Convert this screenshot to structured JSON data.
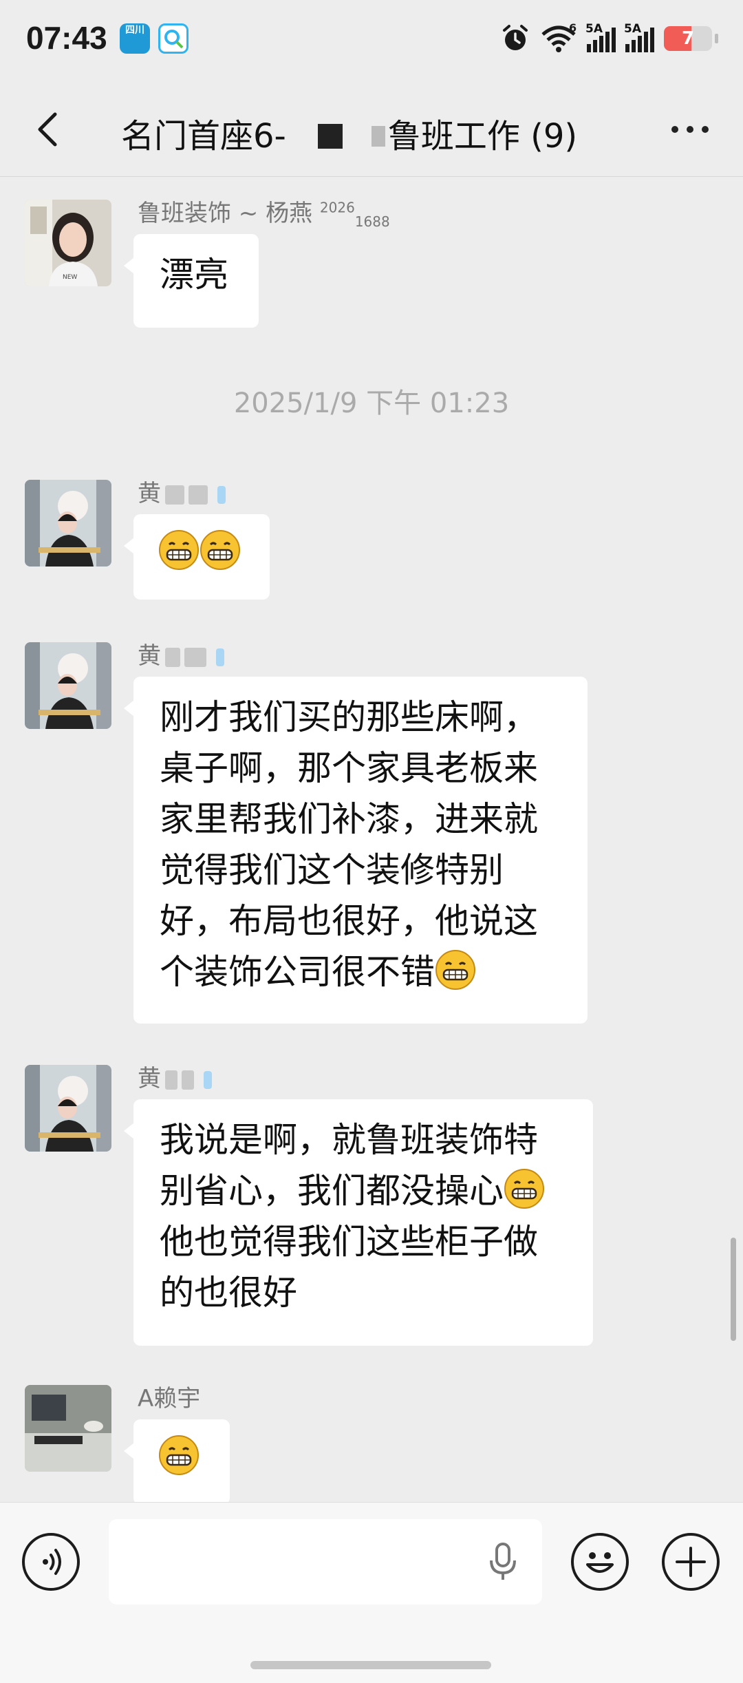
{
  "status_bar": {
    "time": "07:43",
    "app_badge_text": "四川",
    "signal1_label": "5A",
    "signal2_label": "5A",
    "wifi_label": "6",
    "battery_level": "7",
    "battery_fraction": 0.07,
    "icons": [
      "alarm-icon",
      "wifi-icon",
      "signal-icon",
      "signal-icon",
      "battery-icon"
    ]
  },
  "header": {
    "title_part1": "名门首座6-",
    "title_part2": "鲁班工作",
    "member_count": "(9)",
    "back_icon": "chevron-left-icon",
    "more_icon": "more-icon"
  },
  "messages": [
    {
      "sender": "鲁班装饰 ~ 杨燕",
      "sender_sup": "2026",
      "sender_sub": "1688",
      "text": "漂亮"
    },
    {
      "sender": "黄",
      "text": "",
      "emoji_count": 2
    },
    {
      "sender": "黄",
      "text_lines": [
        "刚才我们买的那些床啊，",
        "桌子啊，那个家具老板来",
        "家里帮我们补漆，进来就",
        "觉得我们这个装修特别",
        "好，布局也很好，他说这",
        "个装饰公司很不错"
      ]
    },
    {
      "sender": "黄",
      "text_lines": [
        "我说是啊，就鲁班装饰特",
        "别省心，我们都没操心",
        "他也觉得我们这些柜子做",
        "的也很好"
      ]
    },
    {
      "sender": "A赖宇",
      "text": "",
      "emoji_count": 1
    }
  ],
  "timestamp": "2025/1/9 下午 01:23",
  "input": {
    "placeholder": "",
    "voice_icon": "voice-icon",
    "mic_icon": "mic-icon",
    "emoji_icon": "emoji-icon",
    "plus_icon": "plus-icon"
  },
  "colors": {
    "background": "#ededed",
    "bubble": "#ffffff",
    "battery_low": "#f25c57"
  }
}
